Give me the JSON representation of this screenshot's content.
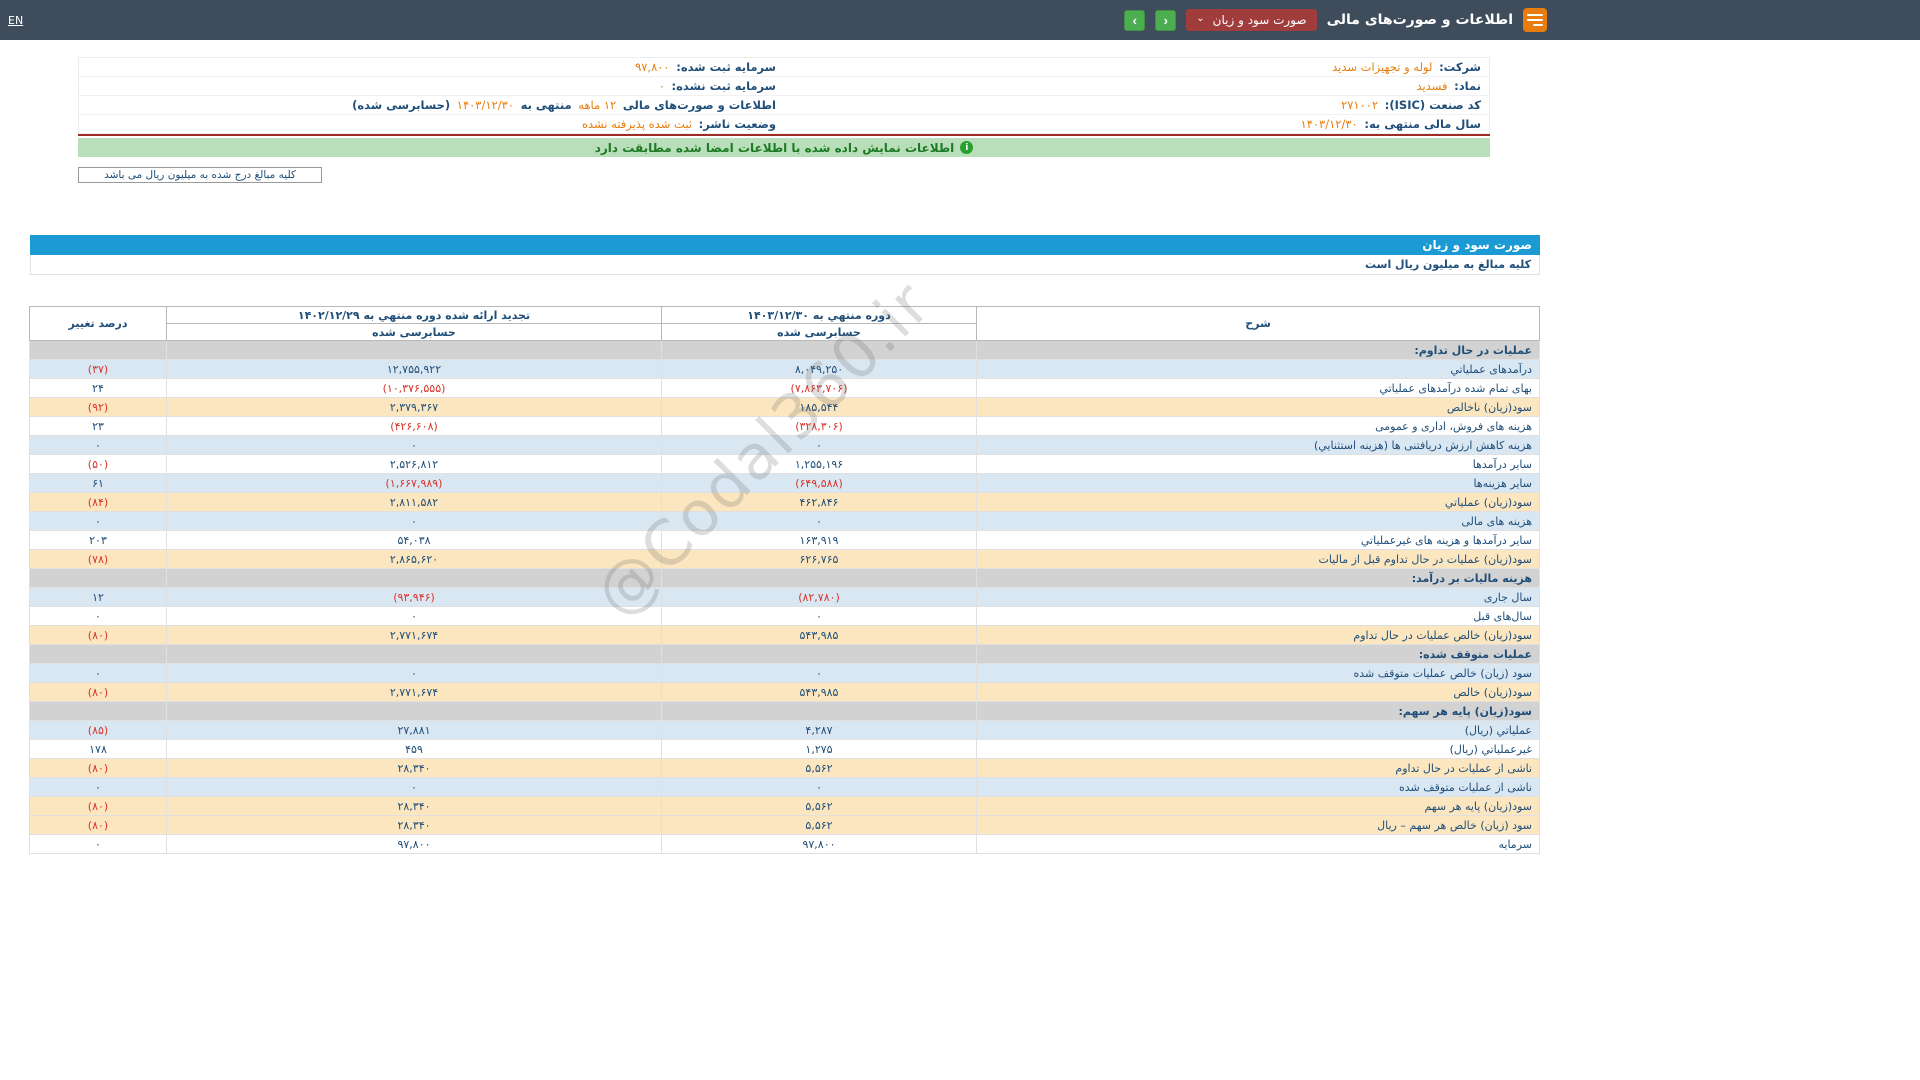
{
  "topbar": {
    "en_label": "EN",
    "title": "اطلاعات و صورت‌های مالی",
    "dropdown_label": "صورت سود و زیان",
    "next_icon": "›",
    "prev_icon": "‹"
  },
  "colors": {
    "topbar": "#3e4c5c",
    "accent_blue": "#1b9ad4",
    "dropdown_red": "#a13c3c",
    "button_green": "#4cae50",
    "value_orange": "#e87d0d",
    "text_navy": "#1f4e79",
    "negative_red": "#d9342b",
    "row_blue": "#d9e7f3",
    "row_yellow": "#fbe6bf",
    "row_section_gray": "#d2d2d2",
    "banner_green": "#b9dfba"
  },
  "info": {
    "company_label": "شرکت:",
    "company_value": "لوله و تجهیزات سدید",
    "symbol_label": "نماد:",
    "symbol_value": "فسدید",
    "isic_label": "کد صنعت (ISIC):",
    "isic_value": "۲۷۱۰۰۲",
    "fiscal_year_label": "سال مالی منتهی به:",
    "fiscal_year_value": "۱۴۰۳/۱۲/۳۰",
    "registered_capital_label": "سرمایه ثبت شده:",
    "registered_capital_value": "۹۷,۸۰۰",
    "unregistered_capital_label": "سرمایه ثبت نشده:",
    "unregistered_capital_value": "۰",
    "statement_label": "اطلاعات و صورت‌های مالی",
    "statement_period": "۱۲ ماهه",
    "statement_mid": "منتهی به",
    "statement_date": "۱۴۰۳/۱۲/۳۰",
    "statement_suffix": "(حسابرسی شده)",
    "publisher_status_label": "وضعیت ناشر:",
    "publisher_status_value": "ثبت شده پذیرفته نشده"
  },
  "banner": {
    "text": "اطلاعات نمایش داده شده با اطلاعات امضا شده مطابقت دارد",
    "icon_glyph": "i"
  },
  "note": {
    "text": "کلیه مبالغ درج شده به میلیون ریال می باشد"
  },
  "watermark": {
    "text": "@Codal360.ir"
  },
  "statement": {
    "title": "صورت سود و زیان",
    "subtitle": "کلیه مبالغ به میلیون ریال است",
    "columns": {
      "desc": "شرح",
      "current": "دوره منتهي به ۱۴۰۳/۱۲/۳۰",
      "current_sub": "حسابرسی شده",
      "restated": "تجدید ارائه شده دوره منتهي به ۱۴۰۲/۱۲/۲۹",
      "restated_sub": "حسابرسی شده",
      "change": "درصد تغییر"
    },
    "rows": [
      {
        "type": "section",
        "label": "عملیات در حال تداوم:"
      },
      {
        "type": "data",
        "style": "blue",
        "label": "درآمدهای عملیاتي",
        "current": "۸,۰۴۹,۲۵۰",
        "restated": "۱۲,۷۵۵,۹۲۲",
        "change": "(۳۷)"
      },
      {
        "type": "data",
        "style": "white",
        "label": "بهای تمام شده درآمدهای عملیاتي",
        "current": "(۷,۸۶۳,۷۰۶)",
        "restated": "(۱۰,۳۷۶,۵۵۵)",
        "change": "۲۴"
      },
      {
        "type": "data",
        "style": "yellow",
        "label": "سود(زیان) ناخالص",
        "current": "۱۸۵,۵۴۴",
        "restated": "۲,۳۷۹,۳۶۷",
        "change": "(۹۲)"
      },
      {
        "type": "data",
        "style": "white",
        "label": "هزینه های فروش، اداری و عمومی",
        "current": "(۳۲۸,۳۰۶)",
        "restated": "(۴۲۶,۶۰۸)",
        "change": "۲۳"
      },
      {
        "type": "data",
        "style": "blue",
        "label": "هزینه کاهش ارزش دریافتنی ها (هزینه استثنایي)",
        "current": "۰",
        "restated": "۰",
        "change": "۰"
      },
      {
        "type": "data",
        "style": "white",
        "label": "سایر درآمدها",
        "current": "۱,۲۵۵,۱۹۶",
        "restated": "۲,۵۲۶,۸۱۲",
        "change": "(۵۰)"
      },
      {
        "type": "data",
        "style": "blue",
        "label": "سایر هزینه‌ها",
        "current": "(۶۴۹,۵۸۸)",
        "restated": "(۱,۶۶۷,۹۸۹)",
        "change": "۶۱"
      },
      {
        "type": "data",
        "style": "yellow",
        "label": "سود(زیان) عملیاتي",
        "current": "۴۶۲,۸۴۶",
        "restated": "۲,۸۱۱,۵۸۲",
        "change": "(۸۴)"
      },
      {
        "type": "data",
        "style": "blue",
        "label": "هزینه های مالی",
        "current": "۰",
        "restated": "۰",
        "change": "۰"
      },
      {
        "type": "data",
        "style": "white",
        "label": "سایر درآمدها و هزینه های غیرعملیاتي",
        "current": "۱۶۳,۹۱۹",
        "restated": "۵۴,۰۳۸",
        "change": "۲۰۳"
      },
      {
        "type": "data",
        "style": "yellow",
        "label": "سود(زیان) عملیات در حال تداوم قبل از مالیات",
        "current": "۶۲۶,۷۶۵",
        "restated": "۲,۸۶۵,۶۲۰",
        "change": "(۷۸)"
      },
      {
        "type": "section",
        "label": "هزینه مالیات بر درآمد:"
      },
      {
        "type": "data",
        "style": "blue",
        "label": "سال جاری",
        "current": "(۸۲,۷۸۰)",
        "restated": "(۹۳,۹۴۶)",
        "change": "۱۲"
      },
      {
        "type": "data",
        "style": "white",
        "label": "سال‌های قبل",
        "current": "۰",
        "restated": "۰",
        "change": "۰"
      },
      {
        "type": "data",
        "style": "yellow",
        "label": "سود(زیان) خالص عملیات در حال تداوم",
        "current": "۵۴۳,۹۸۵",
        "restated": "۲,۷۷۱,۶۷۴",
        "change": "(۸۰)"
      },
      {
        "type": "section",
        "label": "عملیات متوقف شده:"
      },
      {
        "type": "data",
        "style": "blue",
        "label": "سود (زیان) خالص عملیات متوقف شده",
        "current": "۰",
        "restated": "۰",
        "change": "۰"
      },
      {
        "type": "data",
        "style": "yellow",
        "label": "سود(زیان) خالص",
        "current": "۵۴۳,۹۸۵",
        "restated": "۲,۷۷۱,۶۷۴",
        "change": "(۸۰)"
      },
      {
        "type": "section",
        "label": "سود(زیان) پایه هر سهم:"
      },
      {
        "type": "data",
        "style": "blue",
        "label": "عملیاتي (ریال)",
        "current": "۴,۲۸۷",
        "restated": "۲۷,۸۸۱",
        "change": "(۸۵)"
      },
      {
        "type": "data",
        "style": "white",
        "label": "غیرعملیاتي (ریال)",
        "current": "۱,۲۷۵",
        "restated": "۴۵۹",
        "change": "۱۷۸"
      },
      {
        "type": "data",
        "style": "yellow",
        "label": "ناشی از عملیات در حال تداوم",
        "current": "۵,۵۶۲",
        "restated": "۲۸,۳۴۰",
        "change": "(۸۰)"
      },
      {
        "type": "data",
        "style": "blue",
        "label": "ناشی از عملیات متوقف شده",
        "current": "۰",
        "restated": "۰",
        "change": "۰"
      },
      {
        "type": "data",
        "style": "yellow",
        "label": "سود(زیان) پایه هر سهم",
        "current": "۵,۵۶۲",
        "restated": "۲۸,۳۴۰",
        "change": "(۸۰)"
      },
      {
        "type": "data",
        "style": "yellow",
        "label": "سود (زیان) خالص هر سهم – ریال",
        "current": "۵,۵۶۲",
        "restated": "۲۸,۳۴۰",
        "change": "(۸۰)"
      },
      {
        "type": "data",
        "style": "white",
        "label": "سرمایه",
        "current": "۹۷,۸۰۰",
        "restated": "۹۷,۸۰۰",
        "change": "۰"
      }
    ]
  }
}
